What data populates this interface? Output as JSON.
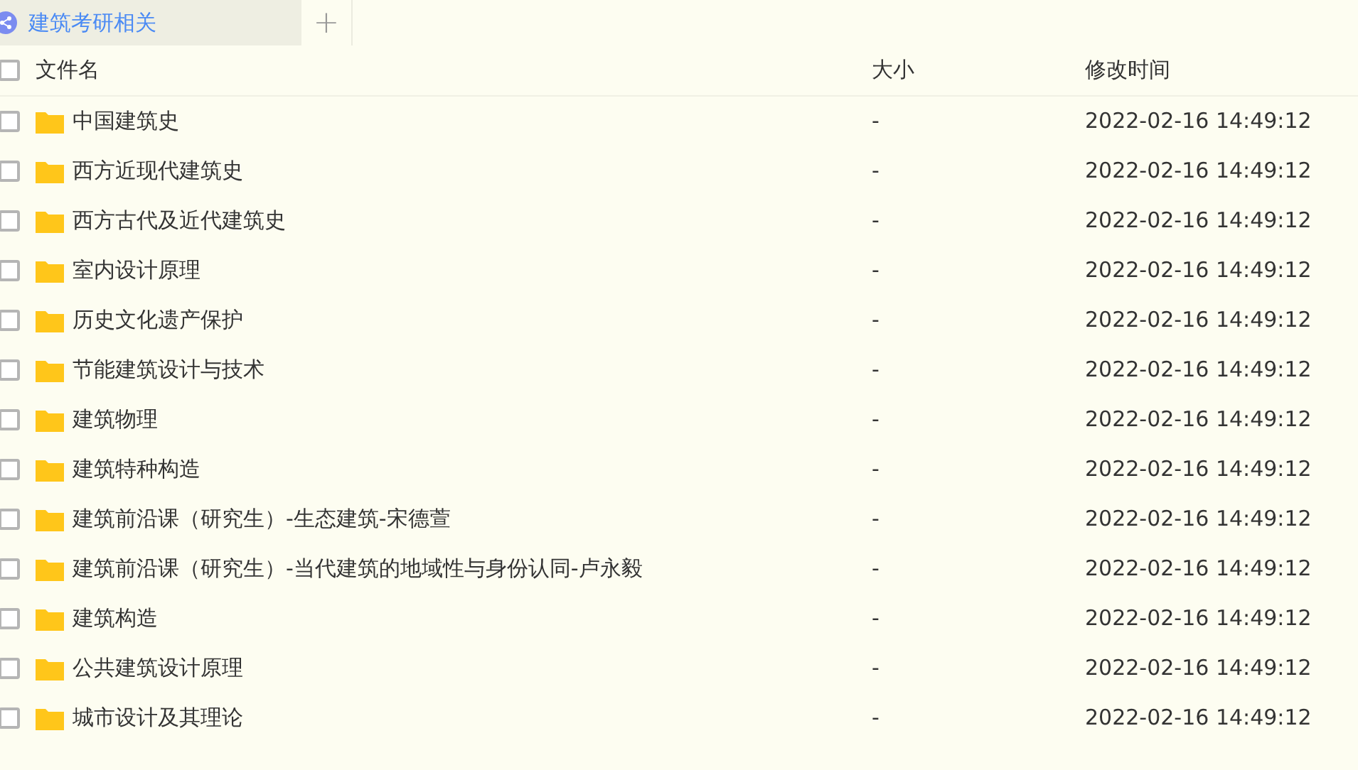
{
  "tab": {
    "label": "建筑考研相关",
    "selected": true,
    "add_label": "+"
  },
  "table": {
    "header": {
      "checked": false,
      "columns": [
        "文件名",
        "大小",
        "修改时间"
      ]
    },
    "rows": [
      {
        "name": "中国建筑史",
        "size": "-",
        "modified": "2022-02-16 14:49:12",
        "checked": false
      },
      {
        "name": "西方近现代建筑史",
        "size": "-",
        "modified": "2022-02-16 14:49:12",
        "checked": false
      },
      {
        "name": "西方古代及近代建筑史",
        "size": "-",
        "modified": "2022-02-16 14:49:12",
        "checked": false
      },
      {
        "name": "室内设计原理",
        "size": "-",
        "modified": "2022-02-16 14:49:12",
        "checked": false
      },
      {
        "name": "历史文化遗产保护",
        "size": "-",
        "modified": "2022-02-16 14:49:12",
        "checked": false
      },
      {
        "name": "节能建筑设计与技术",
        "size": "-",
        "modified": "2022-02-16 14:49:12",
        "checked": false
      },
      {
        "name": "建筑物理",
        "size": "-",
        "modified": "2022-02-16 14:49:12",
        "checked": false
      },
      {
        "name": "建筑特种构造",
        "size": "-",
        "modified": "2022-02-16 14:49:12",
        "checked": false
      },
      {
        "name": "建筑前沿课（研究生）-生态建筑-宋德萱",
        "size": "-",
        "modified": "2022-02-16 14:49:12",
        "checked": false
      },
      {
        "name": "建筑前沿课（研究生）-当代建筑的地域性与身份认同-卢永毅",
        "size": "-",
        "modified": "2022-02-16 14:49:12",
        "checked": false
      },
      {
        "name": "建筑构造",
        "size": "-",
        "modified": "2022-02-16 14:49:12",
        "checked": false
      },
      {
        "name": "公共建筑设计原理",
        "size": "-",
        "modified": "2022-02-16 14:49:12",
        "checked": false
      },
      {
        "name": "城市设计及其理论",
        "size": "-",
        "modified": "2022-02-16 14:49:12",
        "checked": false
      }
    ]
  }
}
